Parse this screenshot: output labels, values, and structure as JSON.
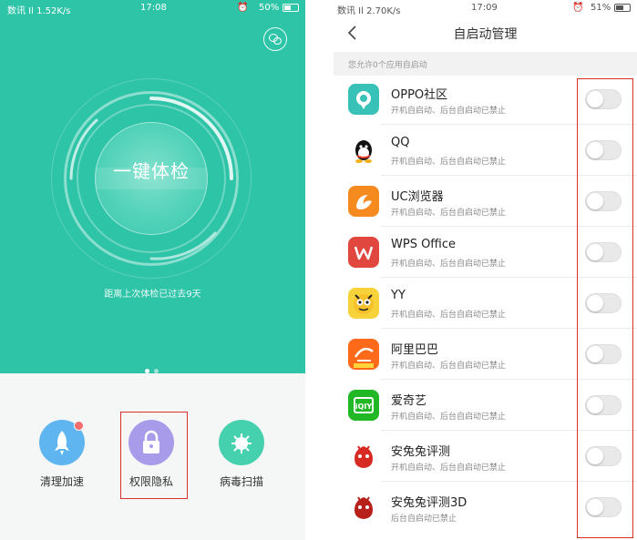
{
  "left_phone": {
    "status": {
      "signal": "数讯 Il 1.52K/s ",
      "time": "17:08",
      "battery": "50%",
      "battery_level": 0.5
    },
    "main_button": "一键体检",
    "last_check": "距离上次体检已过去9天",
    "pager": {
      "pages": 2,
      "active": 0
    },
    "tools": [
      {
        "label": "清理加速",
        "icon": "rocket-icon",
        "color": "#5fb5ef",
        "badge": true
      },
      {
        "label": "权限隐私",
        "icon": "lock-icon",
        "color": "#a89bea",
        "highlighted": true
      },
      {
        "label": "病毒扫描",
        "icon": "virus-icon",
        "color": "#46d1ae"
      }
    ],
    "colors": {
      "header_bg": "#2ec4a8",
      "highlight": "#d9302b"
    }
  },
  "right_phone": {
    "status": {
      "signal": "数讯 Il 2.70K/s ",
      "time": "17:09",
      "battery": "51%",
      "battery_level": 0.51
    },
    "title": "自启动管理",
    "section_header": "您允许0个应用自启动",
    "apps": [
      {
        "name": "OPPO社区",
        "desc": "开机自启动、后台自启动已禁止",
        "icon": "oppo-community-icon",
        "enabled": false
      },
      {
        "name": "QQ",
        "desc": "开机自启动、后台自启动已禁止",
        "icon": "qq-icon",
        "enabled": false
      },
      {
        "name": "UC浏览器",
        "desc": "开机自启动、后台自启动已禁止",
        "icon": "uc-browser-icon",
        "enabled": false
      },
      {
        "name": "WPS Office",
        "desc": "开机自启动、后台自启动已禁止",
        "icon": "wps-office-icon",
        "enabled": false
      },
      {
        "name": "YY",
        "desc": "开机自启动、后台自启动已禁止",
        "icon": "yy-icon",
        "enabled": false
      },
      {
        "name": "阿里巴巴",
        "desc": "开机自启动、后台自启动已禁止",
        "icon": "alibaba-icon",
        "enabled": false
      },
      {
        "name": "爱奇艺",
        "desc": "开机自启动、后台自启动已禁止",
        "icon": "iqiyi-icon",
        "enabled": false
      },
      {
        "name": "安兔兔评测",
        "desc": "开机自启动、后台自启动已禁止",
        "icon": "antutu-icon",
        "enabled": false
      },
      {
        "name": "安兔兔评测3D",
        "desc": "后台自启动已禁止",
        "icon": "antutu-3d-icon",
        "enabled": false
      }
    ],
    "colors": {
      "highlight": "#d9302b",
      "toggle_off": "#e9e9e9"
    }
  }
}
